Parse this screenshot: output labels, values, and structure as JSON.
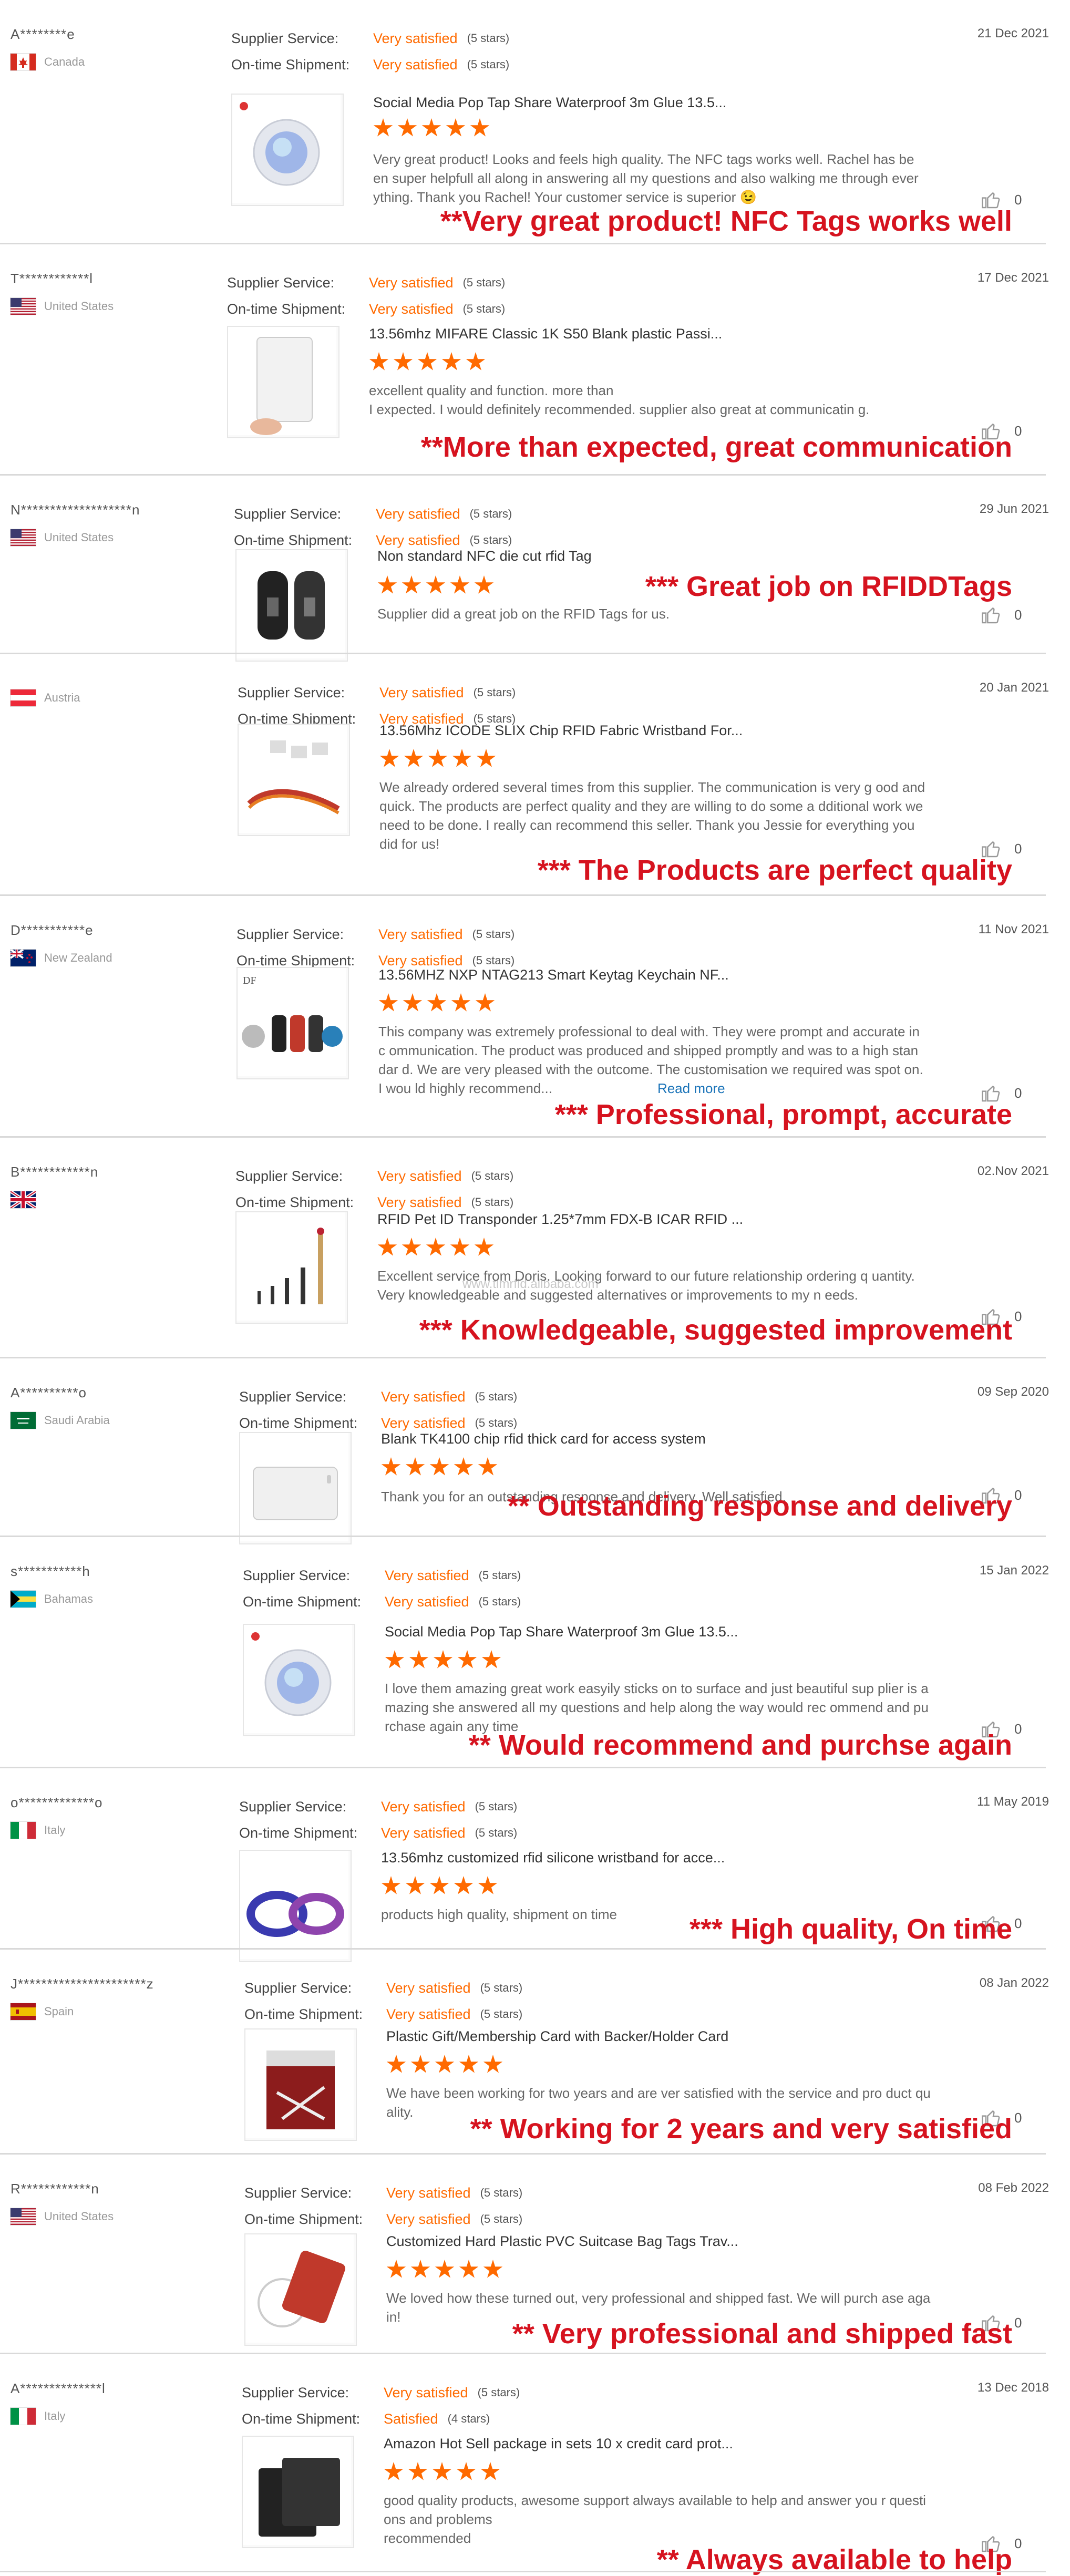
{
  "colors": {
    "accent": "#ff6a00",
    "note": "#d6131f",
    "link": "#1a73b8"
  },
  "labels": {
    "supplier_service": "Supplier Service:",
    "on_time_shipment": "On-time Shipment:",
    "read_more": "Read more"
  },
  "watermark": "www.tlmrfid.alibaba.com",
  "reviews": [
    {
      "buyer": "A********e",
      "country": "Canada",
      "flag": "ca",
      "supplier_rating": "Very satisfied",
      "supplier_stars": "(5 stars)",
      "shipment_rating": "Very satisfied",
      "shipment_stars": "(5 stars)",
      "date": "21 Dec 2021",
      "thumb": "nfc-tag",
      "product": "Social Media Pop Tap Share Waterproof 3m Glue 13.5...",
      "rating": 5,
      "text": "Very great product! Looks and feels high quality. The NFC tags works well. Rachel has been super helpfull all along in answering all my questions and also walking me through everything. Thank you Rachel! Your customer service is superior 😉",
      "likes": "0",
      "note": "**Very great product! NFC Tags works well"
    },
    {
      "buyer": "T************l",
      "country": "United States",
      "flag": "us",
      "supplier_rating": "Very satisfied",
      "supplier_stars": "(5 stars)",
      "shipment_rating": "Very satisfied",
      "shipment_stars": "(5 stars)",
      "date": "17 Dec 2021",
      "thumb": "white-card",
      "product": "13.56mhz MIFARE Classic 1K S50 Blank plastic Passi...",
      "rating": 5,
      "text": "excellent quality and function. more than\nI expected. I would definitely recommended. supplier also great at communicatin g.",
      "likes": "0",
      "note": "**More than expected, great communication"
    },
    {
      "buyer": "N*******************n",
      "country": "United States",
      "flag": "us",
      "supplier_rating": "Very satisfied",
      "supplier_stars": "(5 stars)",
      "shipment_rating": "Very satisfied",
      "shipment_stars": "(5 stars)",
      "date": "29 Jun 2021",
      "thumb": "keyfob",
      "product": "Non standard NFC die cut rfid Tag",
      "rating": 5,
      "text": "Supplier did a great job on the RFID Tags for us.",
      "likes": "0",
      "note": "*** Great  job on RFIDDTags"
    },
    {
      "buyer": "",
      "country": "Austria",
      "flag": "at",
      "supplier_rating": "Very satisfied",
      "supplier_stars": "(5 stars)",
      "shipment_rating": "Very satisfied",
      "shipment_stars": "(5 stars)",
      "date": "20 Jan 2021",
      "thumb": "wristband-fabric",
      "product": "13.56Mhz ICODE SLIX Chip RFID Fabric Wristband For...",
      "rating": 5,
      "text": "We already ordered several times from this supplier. The communication is very g ood and quick. The products are perfect quality and they are willing to do some a dditional work we need to be done. I really can recommend this seller. Thank you Jessie for everything you did for us!",
      "likes": "0",
      "note": "*** The Products are perfect quality"
    },
    {
      "buyer": "D***********e",
      "country": "New Zealand",
      "flag": "nz",
      "supplier_rating": "Very satisfied",
      "supplier_stars": "(5 stars)",
      "shipment_rating": "Very satisfied",
      "shipment_stars": "(5 stars)",
      "date": "11 Nov 2021",
      "thumb": "keytags",
      "product": "13.56MHZ NXP NTAG213 Smart Keytag Keychain NF...",
      "rating": 5,
      "text": "This company was extremely professional to deal with. They were prompt and accurate in c ommunication. The product was produced and shipped promptly and was to a high standar d. We are very pleased with the outcome. The customisation we required was spot on.I wou ld highly recommend...",
      "likes": "0",
      "read_more": true,
      "note": "*** Professional, prompt, accurate"
    },
    {
      "buyer": "B************n",
      "country": "",
      "flag": "gb",
      "supplier_rating": "Very satisfied",
      "supplier_stars": "(5 stars)",
      "shipment_rating": "Very satisfied",
      "shipment_stars": "(5 stars)",
      "date": "02.Nov 2021",
      "thumb": "glass-tags",
      "product": "RFID Pet ID Transponder 1.25*7mm FDX-B ICAR RFID ...",
      "rating": 5,
      "text": "Excellent service from Doris. Looking forward to our future relationship ordering q uantity. Very knowledgeable and suggested alternatives or improvements to my n eeds.",
      "likes": "0",
      "note": "*** Knowledgeable, suggested improvement"
    },
    {
      "buyer": "A**********o",
      "country": "Saudi Arabia",
      "flag": "sa",
      "supplier_rating": "Very satisfied",
      "supplier_stars": "(5 stars)",
      "shipment_rating": "Very satisfied",
      "shipment_stars": "(5 stars)",
      "date": "09 Sep 2020",
      "thumb": "thick-card",
      "product": "Blank TK4100 chip rfid thick card for access system",
      "rating": 5,
      "text": "Thank you for an outstanding response and delivery. Well satisfied.",
      "likes": "0",
      "note": "** Outstanding response and delivery"
    },
    {
      "buyer": "s***********h",
      "country": "Bahamas",
      "flag": "bs",
      "supplier_rating": "Very satisfied",
      "supplier_stars": "(5 stars)",
      "shipment_rating": "Very satisfied",
      "shipment_stars": "(5 stars)",
      "date": "15 Jan 2022",
      "thumb": "nfc-tag",
      "product": "Social Media Pop Tap Share Waterproof 3m Glue 13.5...",
      "rating": 5,
      "text": "I love them amazing great work easyily sticks on to surface and just beautiful sup plier is amazing she answered all my questions and help along the way would rec ommend and purchase again any time",
      "likes": "0",
      "note": "**  Would recommend and purchse again"
    },
    {
      "buyer": "o*************o",
      "country": "Italy",
      "flag": "it",
      "supplier_rating": "Very satisfied",
      "supplier_stars": "(5 stars)",
      "shipment_rating": "Very satisfied",
      "shipment_stars": "(5 stars)",
      "date": "11 May 2019",
      "thumb": "silicone-band",
      "product": "13.56mhz customized rfid silicone wristband for acce...",
      "rating": 5,
      "text": "products high quality, shipment on time",
      "likes": "0",
      "note": "***  High quality, On time"
    },
    {
      "buyer": "J**********************z",
      "country": "Spain",
      "flag": "es",
      "supplier_rating": "Very satisfied",
      "supplier_stars": "(5 stars)",
      "shipment_rating": "Very satisfied",
      "shipment_stars": "(5 stars)",
      "date": "08 Jan 2022",
      "thumb": "gift-card",
      "product": "Plastic Gift/Membership Card with Backer/Holder Card",
      "rating": 5,
      "text": "We have been working for two years and are ver satisfied with the service and pro duct quality.",
      "likes": "0",
      "note": "**  Working for 2 years and very satisfied"
    },
    {
      "buyer": "R************n",
      "country": "United States",
      "flag": "us",
      "supplier_rating": "Very satisfied",
      "supplier_stars": "(5 stars)",
      "shipment_rating": "Very satisfied",
      "shipment_stars": "(5 stars)",
      "date": "08 Feb 2022",
      "thumb": "bag-tag",
      "product": "Customized Hard Plastic PVC Suitcase Bag Tags Trav...",
      "rating": 5,
      "text": "We loved how these turned out, very professional and shipped fast. We will purch ase again!",
      "likes": "0",
      "note": "** Very  professional and shipped fast"
    },
    {
      "buyer": "A**************l",
      "country": "Italy",
      "flag": "it",
      "supplier_rating": "Very satisfied",
      "supplier_stars": "(5 stars)",
      "shipment_rating": "Satisfied",
      "shipment_stars": "(4 stars)",
      "date": "13 Dec 2018",
      "thumb": "sleeves",
      "product": "Amazon Hot Sell package in sets 10 x credit card prot...",
      "rating": 5,
      "text": "good quality products, awesome support always available to help and answer you r questions and problems\nrecommended",
      "likes": "0",
      "note": "**  Always available to help"
    }
  ]
}
